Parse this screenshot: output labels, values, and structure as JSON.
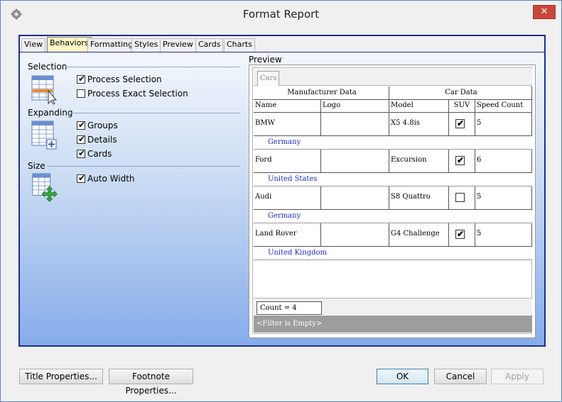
{
  "window": {
    "title": "Format Report",
    "close_symbol": "✕"
  },
  "tabs": [
    {
      "label": "View"
    },
    {
      "label": "Behaviors"
    },
    {
      "label": "Formatting"
    },
    {
      "label": "Styles"
    },
    {
      "label": "Preview"
    },
    {
      "label": "Cards"
    },
    {
      "label": "Charts"
    }
  ],
  "active_tab": "Behaviors",
  "sections": {
    "selection": {
      "label": "Selection",
      "icon": "selection-grid-icon",
      "options": [
        {
          "label": "Process Selection",
          "checked": true
        },
        {
          "label": "Process Exact Selection",
          "checked": false
        }
      ]
    },
    "expanding": {
      "label": "Expanding",
      "icon": "expanding-grid-icon",
      "options": [
        {
          "label": "Groups",
          "checked": true
        },
        {
          "label": "Details",
          "checked": true
        },
        {
          "label": "Cards",
          "checked": true
        }
      ]
    },
    "size": {
      "label": "Size",
      "icon": "size-grid-icon",
      "options": [
        {
          "label": "Auto Width",
          "checked": true
        }
      ]
    }
  },
  "check_mark": "✔",
  "preview": {
    "label": "Preview",
    "tab": "Cars",
    "bands": [
      "Manufacturer Data",
      "Car Data"
    ],
    "columns": [
      "Name",
      "Logo",
      "Model",
      "SUV",
      "Speed Count"
    ],
    "rows": [
      {
        "name": "BMW",
        "logo": "",
        "model": "X5 4.8is",
        "suv": true,
        "speed_count": "5",
        "group": "Germany"
      },
      {
        "name": "Ford",
        "logo": "",
        "model": "Excursion",
        "suv": true,
        "speed_count": "6",
        "group": "United States"
      },
      {
        "name": "Audi",
        "logo": "",
        "model": "S8 Quattro",
        "suv": false,
        "speed_count": "5",
        "group": "Germany"
      },
      {
        "name": "Land Rover",
        "logo": "",
        "model": "G4 Challenge",
        "suv": true,
        "speed_count": "5",
        "group": "United Kingdom"
      }
    ],
    "count_label": "Count = 4",
    "filter_label": "<Filter is Empty>"
  },
  "buttons": {
    "title_properties": "Title Properties...",
    "footnote_properties": "Footnote Properties...",
    "ok": "OK",
    "cancel": "Cancel",
    "apply": "Apply"
  },
  "colors": {
    "frame_border": "#1c2f8c",
    "active_tab_bg": "#fff7c6",
    "group_text": "#1a28d6",
    "close_button": "#c9473a"
  }
}
